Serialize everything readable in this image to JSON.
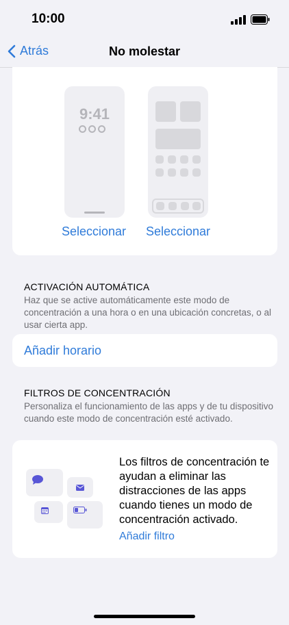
{
  "status": {
    "time": "10:00"
  },
  "nav": {
    "back_label": "Atrás",
    "title": "No molestar"
  },
  "screens": {
    "lock_time": "9:41",
    "select_lock_label": "Seleccionar",
    "select_home_label": "Seleccionar"
  },
  "auto_activation": {
    "header": "ACTIVACIÓN AUTOMÁTICA",
    "description": "Haz que se active automáticamente este modo de concentración a una hora o en una ubicación concretas, o al usar cierta app.",
    "add_schedule_label": "Añadir horario"
  },
  "focus_filters": {
    "header": "FILTROS DE CONCENTRACIÓN",
    "description": "Personaliza el funcionamiento de las apps y de tu dispositivo cuando este modo de concentración esté activado.",
    "card_text": "Los filtros de concentración te ayudan a eliminar las distracciones de las apps cuando tienes un modo de concentración activado.",
    "add_filter_label": "Añadir filtro"
  },
  "colors": {
    "accent": "#2f7bd9",
    "icon_purple": "#5856d6"
  }
}
